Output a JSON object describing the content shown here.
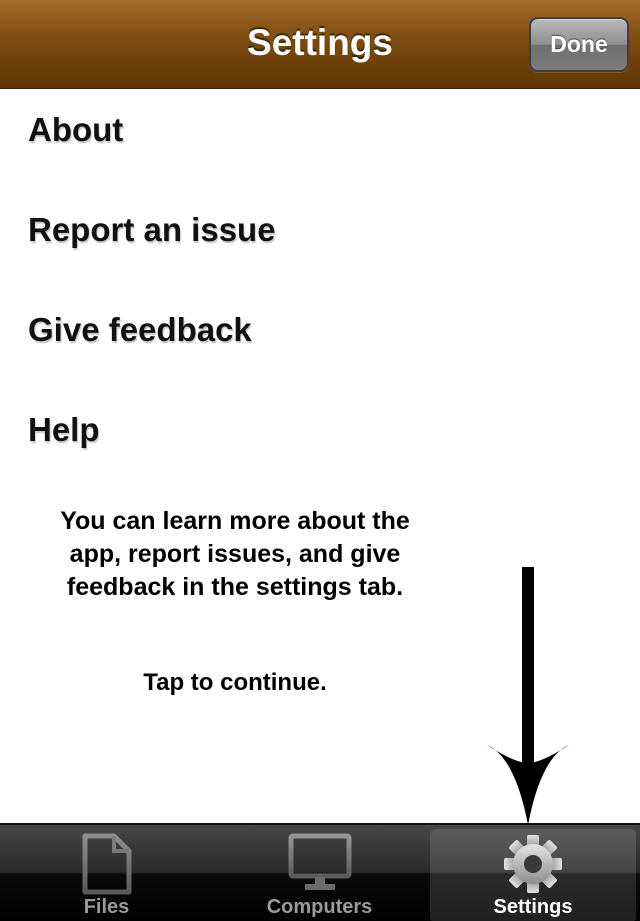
{
  "navbar": {
    "title": "Settings",
    "done_label": "Done",
    "background_color": "#7d4c10"
  },
  "menu": {
    "items": [
      {
        "label": "About"
      },
      {
        "label": "Report an issue"
      },
      {
        "label": "Give feedback"
      },
      {
        "label": "Help"
      }
    ]
  },
  "tutorial": {
    "message_lines": [
      "You can learn more about the",
      "app, report issues, and give",
      "feedback in the settings tab."
    ],
    "continue_label": "Tap to continue.",
    "arrow_icon": "down-arrow-icon"
  },
  "tabbar": {
    "tabs": [
      {
        "label": "Files",
        "icon": "document-icon",
        "selected": false
      },
      {
        "label": "Computers",
        "icon": "monitor-icon",
        "selected": false
      },
      {
        "label": "Settings",
        "icon": "gear-icon",
        "selected": true
      }
    ]
  }
}
